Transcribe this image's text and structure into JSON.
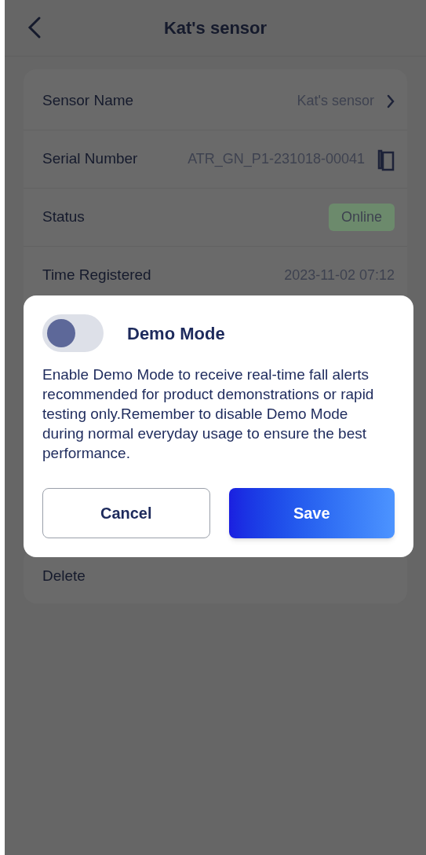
{
  "header": {
    "title": "Kat's sensor"
  },
  "rows": [
    {
      "kind": "link",
      "label": "Sensor Name",
      "value": "Kat's sensor"
    },
    {
      "kind": "copy",
      "label": "Serial Number",
      "value": "ATR_GN_P1-231018-00041"
    },
    {
      "kind": "badge",
      "label": "Status",
      "value": "Online",
      "color": "#6c8a6c"
    },
    {
      "kind": "plain",
      "label": "Time Registered",
      "value": "2023-11-02 07:12"
    }
  ],
  "delete": {
    "label": "Delete"
  },
  "dialog": {
    "title": "Demo Mode",
    "toggle": {
      "on": false
    },
    "message": "Enable Demo Mode to receive real-time fall alerts recommended for product demonstrations or rapid testing only.Remember to disable Demo Mode during normal everyday usage to ensure the best performance.",
    "buttons": [
      {
        "kind": "secondary",
        "label": "Cancel"
      },
      {
        "kind": "primary",
        "label": "Save"
      }
    ]
  }
}
